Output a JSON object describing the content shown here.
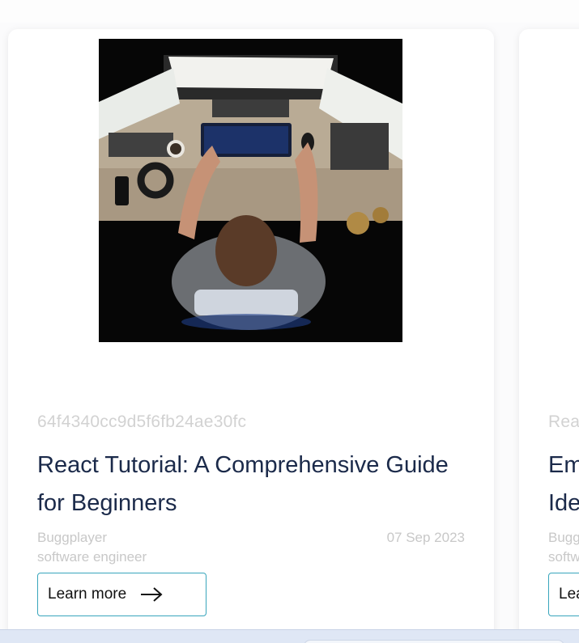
{
  "cards": [
    {
      "id_text": "64f4340cc9d5f6fb24ae30fc",
      "title": "React Tutorial: A Comprehensive Guide for Beginners",
      "author_name": "Buggplayer",
      "author_role": "software engineer",
      "date": "07 Sep 2023",
      "button_label": "Learn more",
      "image_alt": "Person at desk with three monitors, top-down view"
    },
    {
      "id_text": "Rea",
      "title_line1": "Em",
      "title_line2": "Ide",
      "author_name": "Bugg",
      "author_role": "softw",
      "button_label": "Lea"
    }
  ],
  "colors": {
    "title": "#1b2a4a",
    "muted": "#c8c8c8",
    "button_border": "#38a5bc"
  },
  "icons": {
    "button_icon": "arrow-right-icon"
  }
}
